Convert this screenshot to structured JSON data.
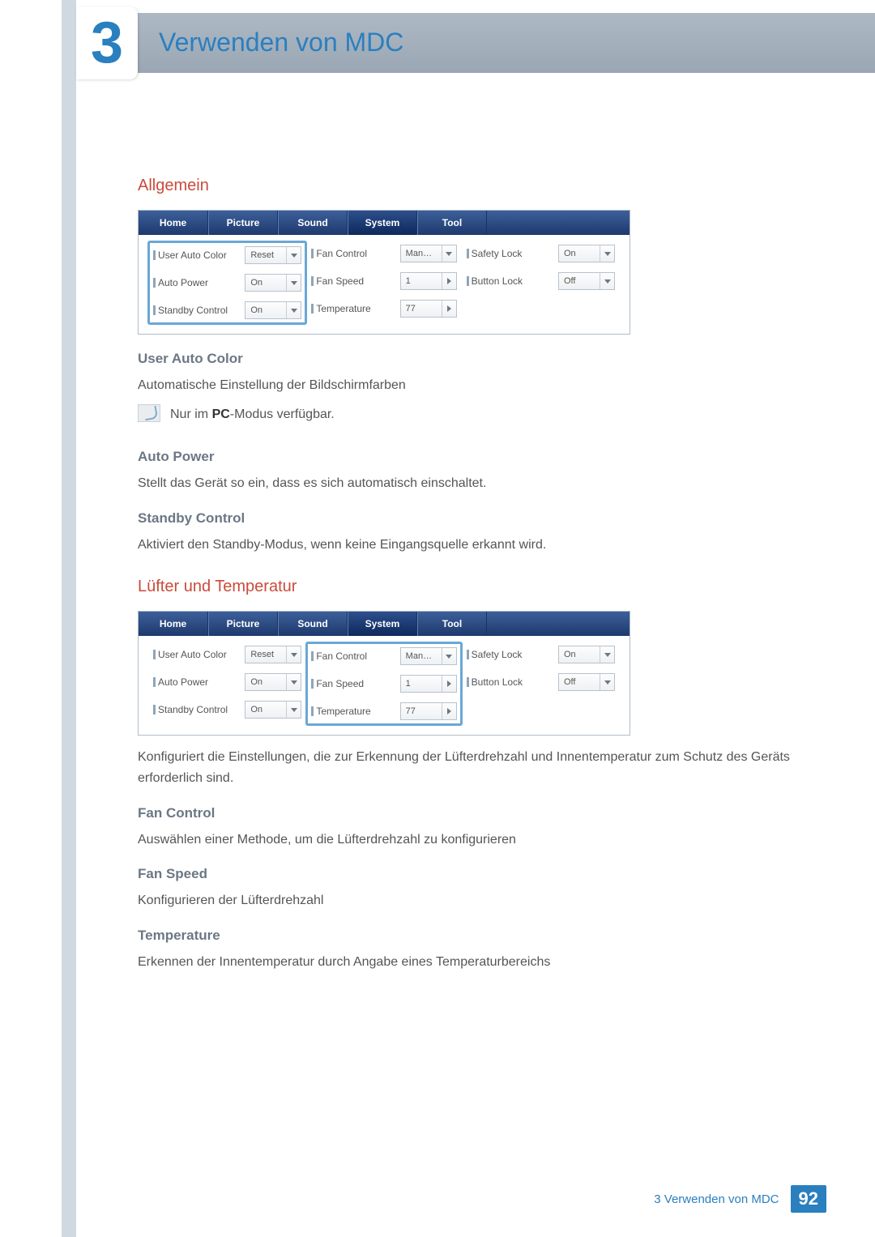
{
  "chapter": {
    "number": "3",
    "title": "Verwenden von MDC"
  },
  "section_allgemein": {
    "heading": "Allgemein",
    "user_auto_color": {
      "heading": "User Auto Color",
      "desc": "Automatische Einstellung der Bildschirmfarben",
      "note_prefix": "Nur im ",
      "note_bold": "PC",
      "note_suffix": "-Modus verfügbar."
    },
    "auto_power": {
      "heading": "Auto Power",
      "desc": "Stellt das Gerät so ein, dass es sich automatisch einschaltet."
    },
    "standby": {
      "heading": "Standby Control",
      "desc": "Aktiviert den Standby-Modus, wenn keine Eingangsquelle erkannt wird."
    }
  },
  "section_luefter": {
    "heading": "Lüfter und Temperatur",
    "desc": "Konfiguriert die Einstellungen, die zur Erkennung der Lüfterdrehzahl und Innentemperatur zum Schutz des Geräts erforderlich sind.",
    "fan_control": {
      "heading": "Fan Control",
      "desc": "Auswählen einer Methode, um die Lüfterdrehzahl zu konfigurieren"
    },
    "fan_speed": {
      "heading": "Fan Speed",
      "desc": "Konfigurieren der Lüfterdrehzahl"
    },
    "temperature": {
      "heading": "Temperature",
      "desc": "Erkennen der Innentemperatur durch Angabe eines Temperaturbereichs"
    }
  },
  "panel": {
    "tabs": [
      "Home",
      "Picture",
      "Sound",
      "System",
      "Tool"
    ],
    "col1": {
      "user_auto_color": {
        "label": "User Auto Color",
        "value": "Reset"
      },
      "auto_power": {
        "label": "Auto Power",
        "value": "On"
      },
      "standby_control": {
        "label": "Standby Control",
        "value": "On"
      }
    },
    "col2": {
      "fan_control": {
        "label": "Fan Control",
        "value": "Man…"
      },
      "fan_speed": {
        "label": "Fan Speed",
        "value": "1"
      },
      "temperature": {
        "label": "Temperature",
        "value": "77"
      }
    },
    "col3": {
      "safety_lock": {
        "label": "Safety Lock",
        "value": "On"
      },
      "button_lock": {
        "label": "Button Lock",
        "value": "Off"
      }
    }
  },
  "footer": {
    "text": "3 Verwenden von MDC",
    "page": "92"
  }
}
